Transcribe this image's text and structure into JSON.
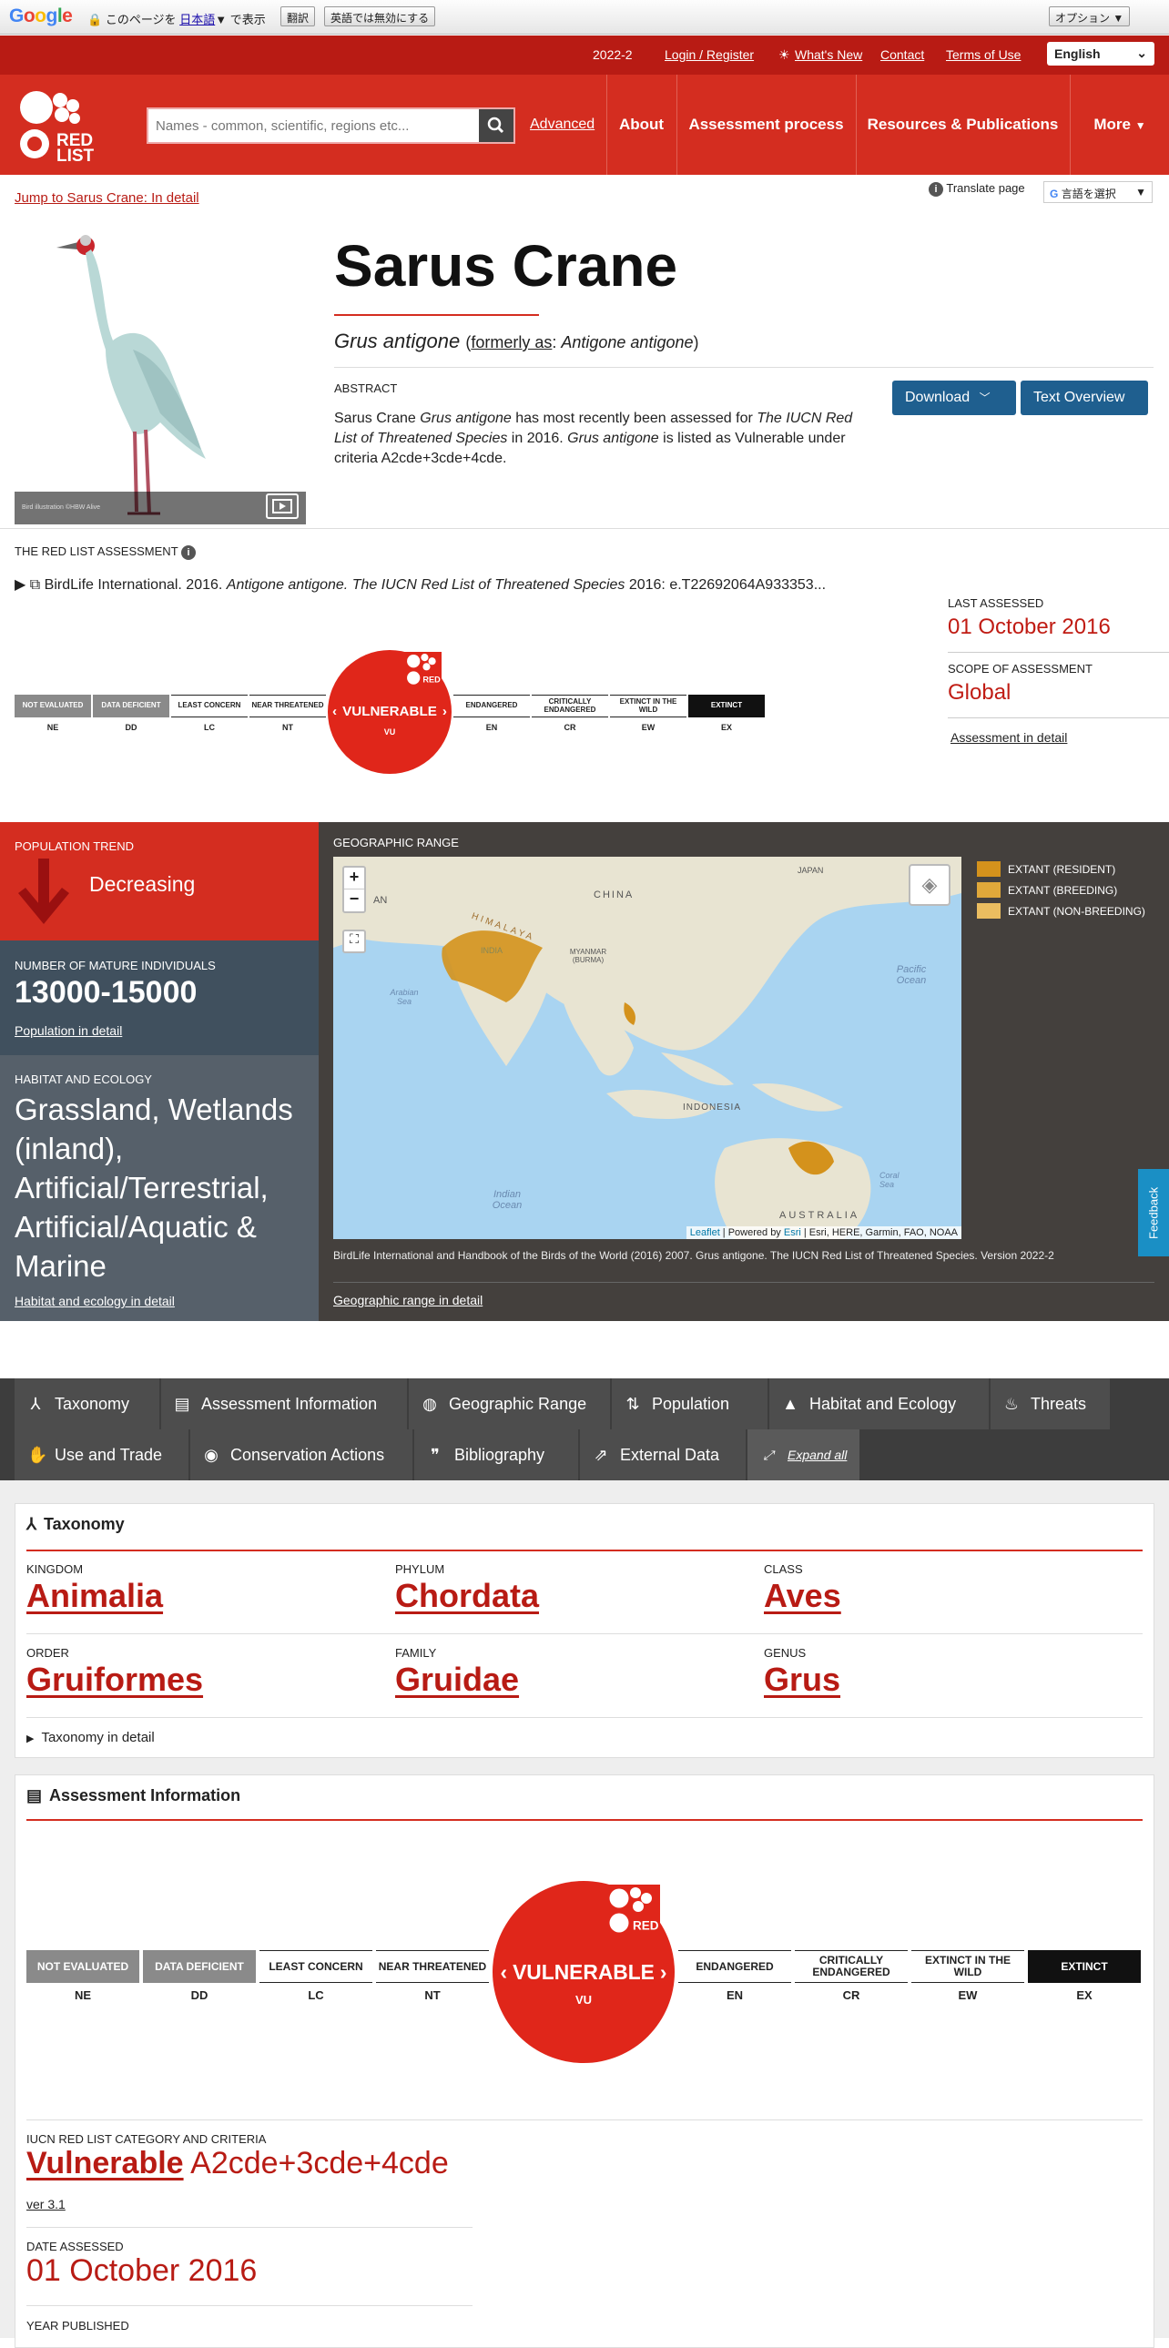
{
  "translate_bar": {
    "logo_text": "Google",
    "prefix": "このページを",
    "language": "日本語",
    "suffix": "で表示",
    "translate_button": "翻訳",
    "disable_button": "英語では無効にする",
    "options_button": "オプション ▼"
  },
  "utility_bar": {
    "version": "2022-2",
    "links": [
      "Login / Register",
      "What's New",
      "Contact",
      "Terms of Use"
    ],
    "language_select": "English"
  },
  "header": {
    "logo_text": "RED LIST",
    "search_placeholder": "Names - common, scientific, regions etc...",
    "advanced": "Advanced",
    "nav": [
      "About",
      "Assessment process",
      "Resources & Publications",
      "More"
    ]
  },
  "page": {
    "jump_link": "Jump to Sarus Crane: In detail",
    "translate_page": "Translate page",
    "google_select": "言語を選択",
    "photo_caption": "Bird illustration ©HBW Alive",
    "title": "Sarus Crane",
    "sci_name": "Grus antigone",
    "formerly_label": "formerly as",
    "formerly_name": "Antigone antigone",
    "abstract_heading": "ABSTRACT",
    "abstract_p1": "Sarus Crane ",
    "abstract_p2": "Grus antigone",
    "abstract_p3": " has most recently been assessed for ",
    "abstract_p4": "The IUCN Red List of Threatened Species",
    "abstract_p5": " in 2016. ",
    "abstract_p6": "Grus antigone",
    "abstract_p7": " is listed as Vulnerable under criteria A2cde+3cde+4cde.",
    "download_button": "Download",
    "text_overview_button": "Text Overview"
  },
  "assessment": {
    "heading": "THE RED LIST ASSESSMENT",
    "citation_a": "BirdLife International. 2016. ",
    "citation_b": "Antigone antigone. The IUCN Red List of Threatened Species",
    "citation_c": " 2016: e.T22692064A933353...",
    "last_assessed_label": "LAST ASSESSED",
    "last_assessed_value": "01 October 2016",
    "scope_label": "SCOPE OF ASSESSMENT",
    "scope_value": "Global",
    "detail_link": "Assessment in detail"
  },
  "categories": [
    {
      "label": "NOT EVALUATED",
      "code": "NE",
      "bg": "#8a8a8a",
      "fg": "#ffffff"
    },
    {
      "label": "DATA DEFICIENT",
      "code": "DD",
      "bg": "#8a8a8a",
      "fg": "#ffffff"
    },
    {
      "label": "LEAST CONCERN",
      "code": "LC",
      "bg": "#ffffff",
      "fg": "#222222"
    },
    {
      "label": "NEAR THREATENED",
      "code": "NT",
      "bg": "#ffffff",
      "fg": "#222222"
    },
    {
      "label": "VULNERABLE",
      "code": "VU",
      "bg": "#e0261a",
      "fg": "#ffffff"
    },
    {
      "label": "ENDANGERED",
      "code": "EN",
      "bg": "#ffffff",
      "fg": "#222222"
    },
    {
      "label": "CRITICALLY ENDANGERED",
      "code": "CR",
      "bg": "#ffffff",
      "fg": "#222222"
    },
    {
      "label": "EXTINCT IN THE WILD",
      "code": "EW",
      "bg": "#ffffff",
      "fg": "#222222"
    },
    {
      "label": "EXTINCT",
      "code": "EX",
      "bg": "#111111",
      "fg": "#ffffff"
    }
  ],
  "population": {
    "trend_label": "POPULATION TREND",
    "trend_value": "Decreasing",
    "mature_label": "NUMBER OF MATURE INDIVIDUALS",
    "mature_value": "13000-15000",
    "pop_link": "Population in detail",
    "habitat_label": "HABITAT AND ECOLOGY",
    "habitat_value": "Grassland, Wetlands (inland), Artificial/Terrestrial, Artificial/Aquatic & Marine",
    "habitat_link": "Habitat and ecology in detail"
  },
  "geo": {
    "heading": "GEOGRAPHIC RANGE",
    "legend": [
      {
        "label": "EXTANT (RESIDENT)",
        "color": "#d4921c"
      },
      {
        "label": "EXTANT (BREEDING)",
        "color": "#e0a83a"
      },
      {
        "label": "EXTANT (NON-BREEDING)",
        "color": "#ebbd60"
      }
    ],
    "map_labels": [
      "JAPAN",
      "CHINA",
      "HIMALAYA",
      "INDIA",
      "MYANMAR (BURMA)",
      "Pacific Ocean",
      "Arabian Sea",
      "INDONESIA",
      "Indian Ocean",
      "AUSTRALIA",
      "Coral Sea",
      "AN"
    ],
    "attribution_a": "Leaflet",
    "attribution_b": " | Powered by ",
    "attribution_c": "Esri",
    "attribution_d": " | Esri, HERE, Garmin, FAO, NOAA",
    "citation": "BirdLife International and Handbook of the Birds of the World (2016) 2007. Grus antigone. The IUCN Red List of Threatened Species. Version 2022-2",
    "link": "Geographic range in detail",
    "feedback": "Feedback"
  },
  "tabs": [
    "Taxonomy",
    "Assessment Information",
    "Geographic Range",
    "Population",
    "Habitat and Ecology",
    "Threats",
    "Use and Trade",
    "Conservation Actions",
    "Bibliography",
    "External Data",
    "Expand all"
  ],
  "taxonomy": {
    "heading": "Taxonomy",
    "items": [
      {
        "label": "KINGDOM",
        "value": "Animalia"
      },
      {
        "label": "PHYLUM",
        "value": "Chordata"
      },
      {
        "label": "CLASS",
        "value": "Aves"
      },
      {
        "label": "ORDER",
        "value": "Gruiformes"
      },
      {
        "label": "FAMILY",
        "value": "Gruidae"
      },
      {
        "label": "GENUS",
        "value": "Grus"
      }
    ],
    "detail": "Taxonomy in detail"
  },
  "assessment_info": {
    "heading": "Assessment Information",
    "category_label": "IUCN RED LIST CATEGORY AND CRITERIA",
    "category_value": "Vulnerable",
    "criteria_value": "A2cde+3cde+4cde",
    "version": "ver 3.1",
    "date_label": "DATE ASSESSED",
    "date_value": "01 October 2016",
    "year_label": "YEAR PUBLISHED"
  }
}
